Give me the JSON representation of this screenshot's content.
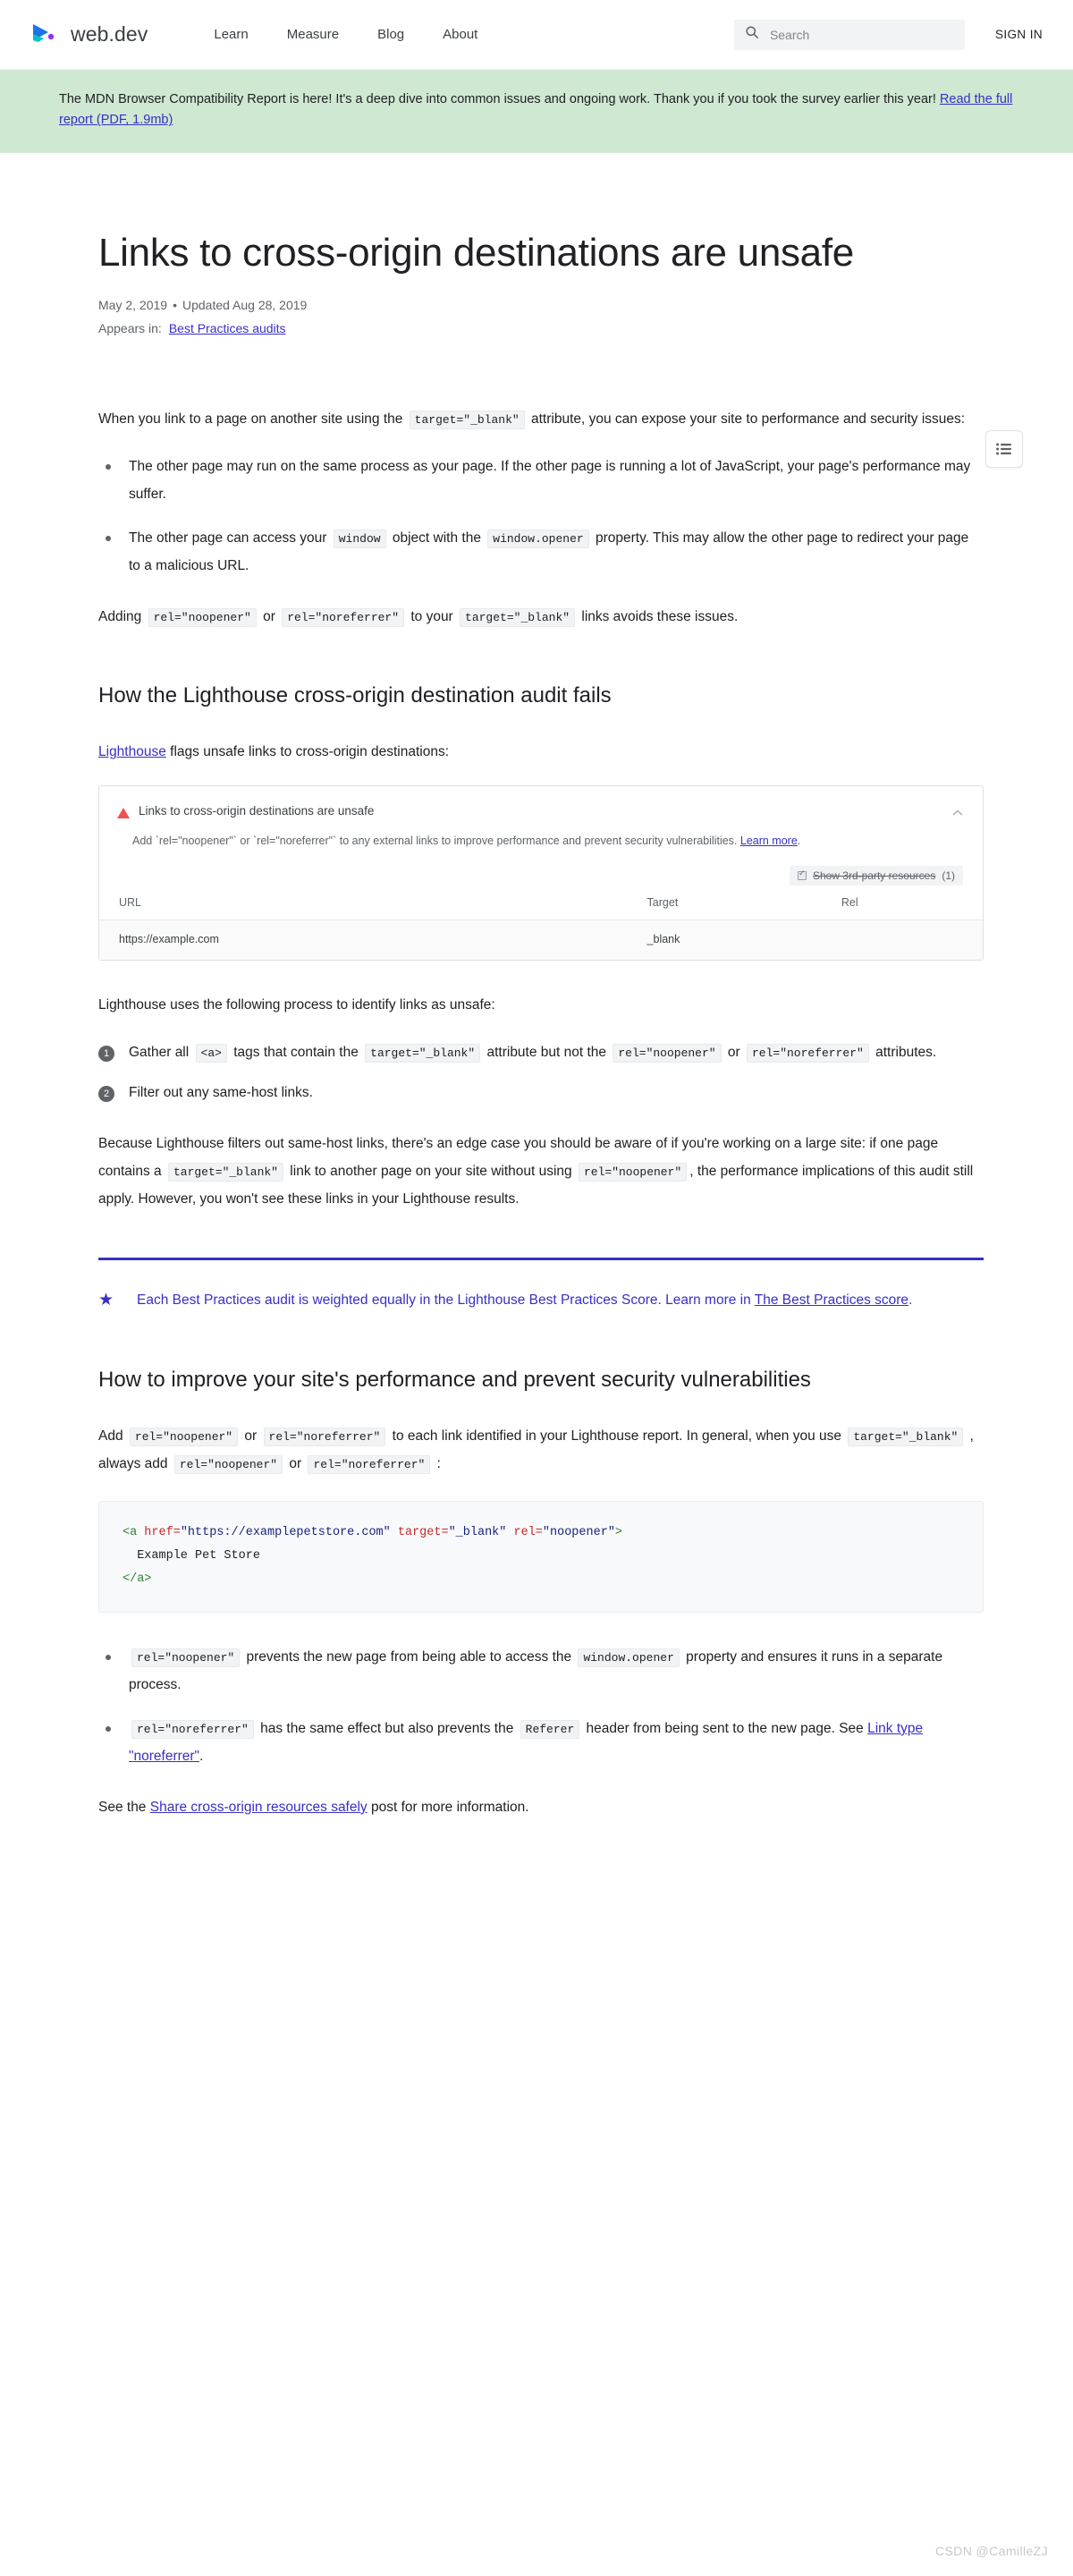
{
  "header": {
    "brand": "web.dev",
    "logo_icon": "webdev-chevron-logo",
    "nav": [
      {
        "label": "Learn"
      },
      {
        "label": "Measure"
      },
      {
        "label": "Blog"
      },
      {
        "label": "About"
      }
    ],
    "search": {
      "placeholder": "Search",
      "value": "",
      "icon": "search-icon"
    },
    "signin": "SIGN IN"
  },
  "banner": {
    "text_before": "The MDN Browser Compatibility Report is here! It's a deep dive into common issues and ongoing work. Thank you if you took the survey earlier this year! ",
    "link": "Read the full report (PDF, 1.9mb)",
    "bg_color": "#cfe8d2"
  },
  "toc_button": {
    "icon": "list-toc-icon",
    "label": ""
  },
  "article": {
    "title": "Links to cross-origin destinations are unsafe",
    "published": "May 2, 2019",
    "separator": "•",
    "updated": "Updated Aug 28, 2019",
    "appears_in_label": "Appears in:",
    "appears_in_link": "Best Practices audits",
    "intro": {
      "t1": "When you link to a page on another site using the ",
      "c1": "target=\"_blank\"",
      "t2": " attribute, you can expose your site to performance and security issues:"
    },
    "intro_bullets": [
      {
        "t1": "The other page may run on the same process as your page. If the other page is running a lot of JavaScript, your page's performance may suffer.",
        "c1": "",
        "t2": "",
        "c2": "",
        "t3": ""
      },
      {
        "t1": "The other page can access your ",
        "c1": "window",
        "t2": " object with the ",
        "c2": "window.opener",
        "t3": " property. This may allow the other page to redirect your page to a malicious URL."
      }
    ],
    "adding_para": {
      "t1": "Adding ",
      "c1": "rel=\"noopener\"",
      "t2": " or ",
      "c2": "rel=\"noreferrer\"",
      "t3": " to your ",
      "c3": "target=\"_blank\"",
      "t4": " links avoids these issues."
    },
    "section1_heading": "How the Lighthouse cross-origin destination audit fails",
    "section1_para": {
      "link": "Lighthouse",
      "t1": " flags unsafe links to cross-origin destinations:"
    },
    "lighthouse_card": {
      "warn_icon": "warning-triangle-icon",
      "title": "Links to cross-origin destinations are unsafe",
      "collapse_icon": "chevron-up-icon",
      "description": "Add `rel=\"noopener\"` or `rel=\"noreferrer\"` to any external links to improve performance and prevent security vulnerabilities. ",
      "description_link": "Learn more",
      "description_end": ".",
      "filter_checkbox_icon": "checkbox-checked-icon",
      "filter_label": "Show 3rd-party resources",
      "filter_count": "(1)",
      "columns": [
        "URL",
        "Target",
        "Rel"
      ],
      "rows": [
        {
          "url": "https://example.com",
          "target": "_blank",
          "rel": ""
        }
      ]
    },
    "process_para": "Lighthouse uses the following process to identify links as unsafe:",
    "process_steps": [
      {
        "num": "1",
        "t1": "Gather all ",
        "c1": "<a>",
        "t2": " tags that contain the ",
        "c2": "target=\"_blank\"",
        "t3": " attribute but not the ",
        "c3": "rel=\"noopener\"",
        "t4": " or ",
        "c4": "rel=\"noreferrer\"",
        "t5": " attributes."
      },
      {
        "num": "2",
        "t1": "Filter out any same-host links.",
        "c1": "",
        "t2": "",
        "c2": "",
        "t3": "",
        "c3": "",
        "t4": "",
        "c4": "",
        "t5": ""
      }
    ],
    "edge_case_para": {
      "t1": "Because Lighthouse filters out same-host links, there's an edge case you should be aware of if you're working on a large site: if one page contains a ",
      "c1": "target=\"_blank\"",
      "t2": " link to another page on your site without using ",
      "c2": "rel=\"noopener\"",
      "t3": ", the performance implications of this audit still apply. However, you won't see these links in your Lighthouse results."
    },
    "callout": {
      "star_icon": "star-icon",
      "t1": "Each Best Practices audit is weighted equally in the Lighthouse Best Practices Score. Learn more in ",
      "link": "The Best Practices score",
      "t2": ".",
      "accent_color": "#3730c4"
    },
    "section2_heading": "How to improve your site's performance and prevent security vulnerabilities",
    "improve_para": {
      "t1": "Add ",
      "c1": "rel=\"noopener\"",
      "t2": " or ",
      "c2": "rel=\"noreferrer\"",
      "t3": " to each link identified in your Lighthouse report. In general, when you use ",
      "c3": "target=\"_blank\"",
      "t4": " , always add ",
      "c4": "rel=\"noopener\"",
      "t5": " or ",
      "c5": "rel=\"noreferrer\"",
      "t6": " :"
    },
    "code_block": {
      "line1_tag_open": "<a",
      "line1_attr1": " href=",
      "line1_val1": "\"https://examplepetstore.com\"",
      "line1_attr2": " target=",
      "line1_val2": "\"_blank\"",
      "line1_attr3": " rel=",
      "line1_val3": "\"noopener\"",
      "line1_close": ">",
      "line2": "  Example Pet Store",
      "line3": "</a>"
    },
    "final_bullets": [
      {
        "c1": "rel=\"noopener\"",
        "t1": " prevents the new page from being able to access the ",
        "c2": "window.opener",
        "t2": " property and ensures it runs in a separate process.",
        "link": "",
        "t3": ""
      },
      {
        "c1": "rel=\"noreferrer\"",
        "t1": " has the same effect but also prevents the ",
        "c2": "Referer",
        "t2": " header from being sent to the new page. See ",
        "link": "Link type \"noreferrer\"",
        "t3": "."
      }
    ],
    "see_also": {
      "t1": "See the ",
      "link": "Share cross-origin resources safely",
      "t2": " post for more information."
    }
  },
  "watermark": "CSDN @CamilleZJ"
}
